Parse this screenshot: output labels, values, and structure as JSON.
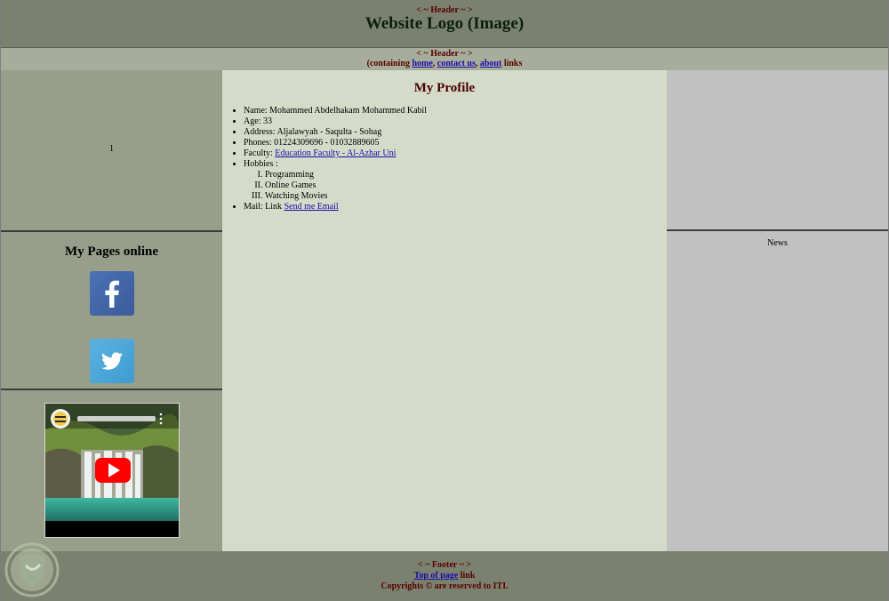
{
  "header": {
    "tag": "< ~ Header ~ >",
    "logo": "Website Logo (Image)"
  },
  "nav": {
    "tag": "< ~ Header ~ >",
    "prefix": "(containing ",
    "home": "home",
    "sep1": ", ",
    "contact": "contact us",
    "sep2": ", ",
    "about": "about",
    "suffix": " links"
  },
  "left": {
    "cell_number": "1",
    "social_title": "My Pages online",
    "facebook_icon": "facebook-icon",
    "twitter_icon": "twitter-icon"
  },
  "profile": {
    "title": "My Profile",
    "name": "Name: Mohammed Abdelhakam Mohammed Kabil",
    "age": "Age: 33",
    "address": "Address: Aljalawyah - Saqulta - Sohag",
    "phones": "Phones: 01224309696 - 01032889605",
    "faculty_label": "Faculty: ",
    "faculty_link": "Education Faculty - Al-Azhar Uni",
    "hobbies_label": "Hobbies :",
    "hobbies": [
      "Programming",
      "Online Games",
      "Watching Movies"
    ],
    "mail_label": "Mail: Link ",
    "mail_link": "Send me Email"
  },
  "right": {
    "news": "News"
  },
  "footer": {
    "tag": "< ~ Footer ~ >",
    "top_link": "Top of page",
    "top_suffix": " link",
    "copyright": "Copyrights © are reserved to ITI."
  },
  "colors": {
    "header_bg": "#7a816e",
    "nav_bg": "#a7ad9b",
    "left_bg": "#979e8a",
    "main_bg": "#d4dbc8",
    "right_bg": "#c1c1c1",
    "link": "#1a0dab",
    "accent_red": "#5a0000"
  }
}
